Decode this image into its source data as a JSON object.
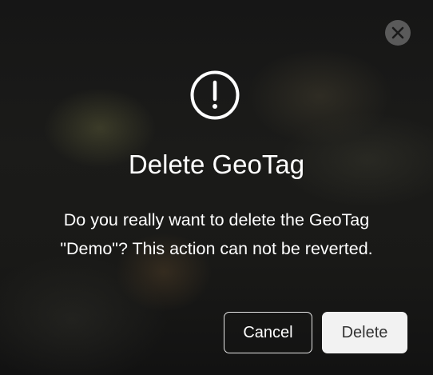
{
  "dialog": {
    "close_icon": "close-icon",
    "alert_icon": "exclamation-circle-icon",
    "title": "Delete GeoTag",
    "message_line1": "Do you really want to delete the GeoTag",
    "message_line2": "\"Demo\"? This action can not be reverted.",
    "cancel_label": "Cancel",
    "delete_label": "Delete"
  },
  "colors": {
    "backdrop": "#141414",
    "text": "#ffffff",
    "close_bg": "#5a5a5a",
    "delete_bg": "#f2f2f2",
    "delete_text": "#333333",
    "cancel_border": "#e6e6e6"
  }
}
